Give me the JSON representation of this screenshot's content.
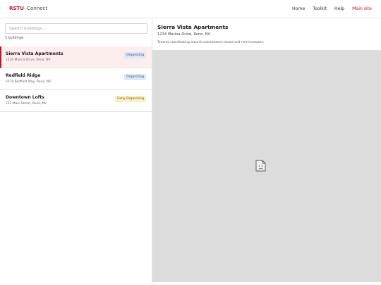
{
  "header": {
    "brand_bold": "RSTU",
    "brand_rest": "Connect",
    "nav": [
      "Home",
      "Toolkit",
      "Help",
      "Main site"
    ]
  },
  "sidebar": {
    "search_placeholder": "Search buildings...",
    "count_text": "3 buildings",
    "buildings": [
      {
        "name": "Sierra Vista Apartments",
        "address": "1234 Marina Drive, Reno, NV",
        "status": "Organizing",
        "selected": true
      },
      {
        "name": "Redfield Ridge",
        "address": "5678 Redfield Way, Reno, NV",
        "status": "Organizing",
        "selected": false
      },
      {
        "name": "Downtown Lofts",
        "address": "123 Main Street, Reno, NV",
        "status": "Early Organizing",
        "selected": false
      }
    ]
  },
  "detail": {
    "title": "Sierra Vista Apartments",
    "address": "1234 Marina Drive, Reno, NV",
    "description": "Tenants coordinating around maintenance issues and rent increases.",
    "image_icon": "broken-image-icon"
  },
  "colors": {
    "brand": "#c8102e",
    "selected_bg": "#fdeeee",
    "badge_organizing": "#dde8f7",
    "badge_early": "#fbf0c3",
    "map_placeholder": "#dcdcdc"
  }
}
